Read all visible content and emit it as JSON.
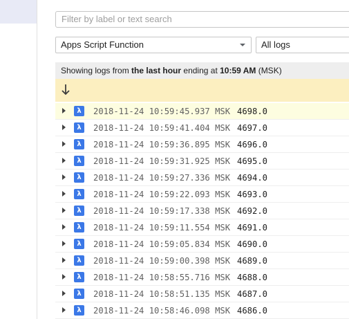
{
  "search": {
    "placeholder": "Filter by label or text search"
  },
  "filters": {
    "resource_selected": "Apps Script Function",
    "log_level_selected": "All logs"
  },
  "info_bar": {
    "prefix": "Showing logs from ",
    "range": "the last hour",
    "middle": " ending at ",
    "time": "10:59 AM",
    "suffix": " (MSK)"
  },
  "icons": {
    "scroll_to_latest": "arrow-down-icon",
    "entry_type": "lambda-function-icon",
    "expand": "caret-right-icon"
  },
  "colors": {
    "lambda_badge": "#3b78e7",
    "highlight_bar": "#fcefc0",
    "highlight_row": "#fdfde0"
  },
  "log_entries": [
    {
      "timestamp": "2018-11-24 10:59:45.937 MSK",
      "value": "4698.0",
      "highlighted": true
    },
    {
      "timestamp": "2018-11-24 10:59:41.404 MSK",
      "value": "4697.0"
    },
    {
      "timestamp": "2018-11-24 10:59:36.895 MSK",
      "value": "4696.0"
    },
    {
      "timestamp": "2018-11-24 10:59:31.925 MSK",
      "value": "4695.0"
    },
    {
      "timestamp": "2018-11-24 10:59:27.336 MSK",
      "value": "4694.0"
    },
    {
      "timestamp": "2018-11-24 10:59:22.093 MSK",
      "value": "4693.0"
    },
    {
      "timestamp": "2018-11-24 10:59:17.338 MSK",
      "value": "4692.0"
    },
    {
      "timestamp": "2018-11-24 10:59:11.554 MSK",
      "value": "4691.0"
    },
    {
      "timestamp": "2018-11-24 10:59:05.834 MSK",
      "value": "4690.0"
    },
    {
      "timestamp": "2018-11-24 10:59:00.398 MSK",
      "value": "4689.0"
    },
    {
      "timestamp": "2018-11-24 10:58:55.716 MSK",
      "value": "4688.0"
    },
    {
      "timestamp": "2018-11-24 10:58:51.135 MSK",
      "value": "4687.0"
    },
    {
      "timestamp": "2018-11-24 10:58:46.098 MSK",
      "value": "4686.0"
    }
  ]
}
